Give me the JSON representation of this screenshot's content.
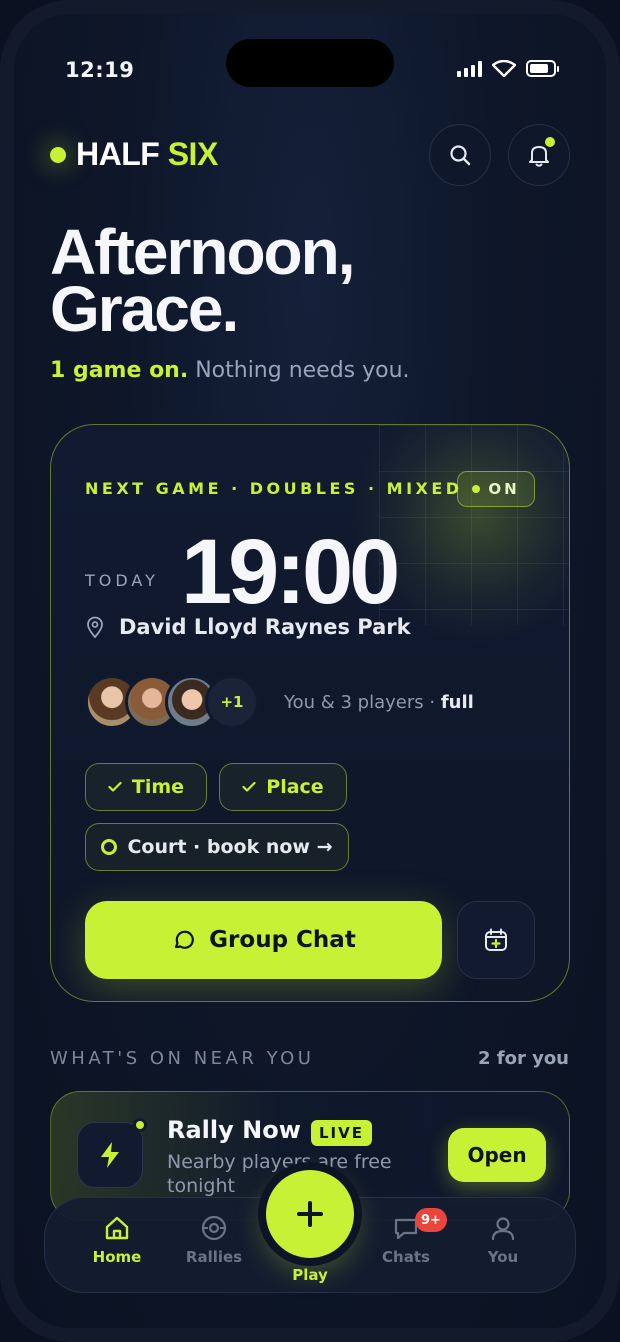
{
  "status": {
    "time": "12:19"
  },
  "brand": {
    "part1": "HALF",
    "part2": "SIX"
  },
  "greeting": {
    "line1": "Afternoon,",
    "line2": "Grace.",
    "highlight": "1 game on.",
    "rest": "Nothing needs you."
  },
  "next_game": {
    "label": "NEXT GAME · DOUBLES · MIXED",
    "status": "ON",
    "day": "TODAY",
    "time": "19:00",
    "venue": "David Lloyd Raynes Park",
    "extra_players": "+1",
    "players_text": "You & 3 players ·",
    "players_status": "full",
    "chips": {
      "time": "Time",
      "place": "Place",
      "court": "Court · book now →"
    },
    "chat_button": "Group Chat"
  },
  "nearby": {
    "section_title": "WHAT'S ON NEAR YOU",
    "count": "2 for you",
    "rally": {
      "title": "Rally Now",
      "badge": "LIVE",
      "subtitle": "Nearby players are free tonight",
      "action": "Open"
    }
  },
  "nav": {
    "home": "Home",
    "rallies": "Rallies",
    "play": "Play",
    "chats": "Chats",
    "chats_badge": "9+",
    "you": "You"
  },
  "colors": {
    "accent": "#c6f135",
    "background": "#0e1729",
    "badge": "#e8453c"
  }
}
